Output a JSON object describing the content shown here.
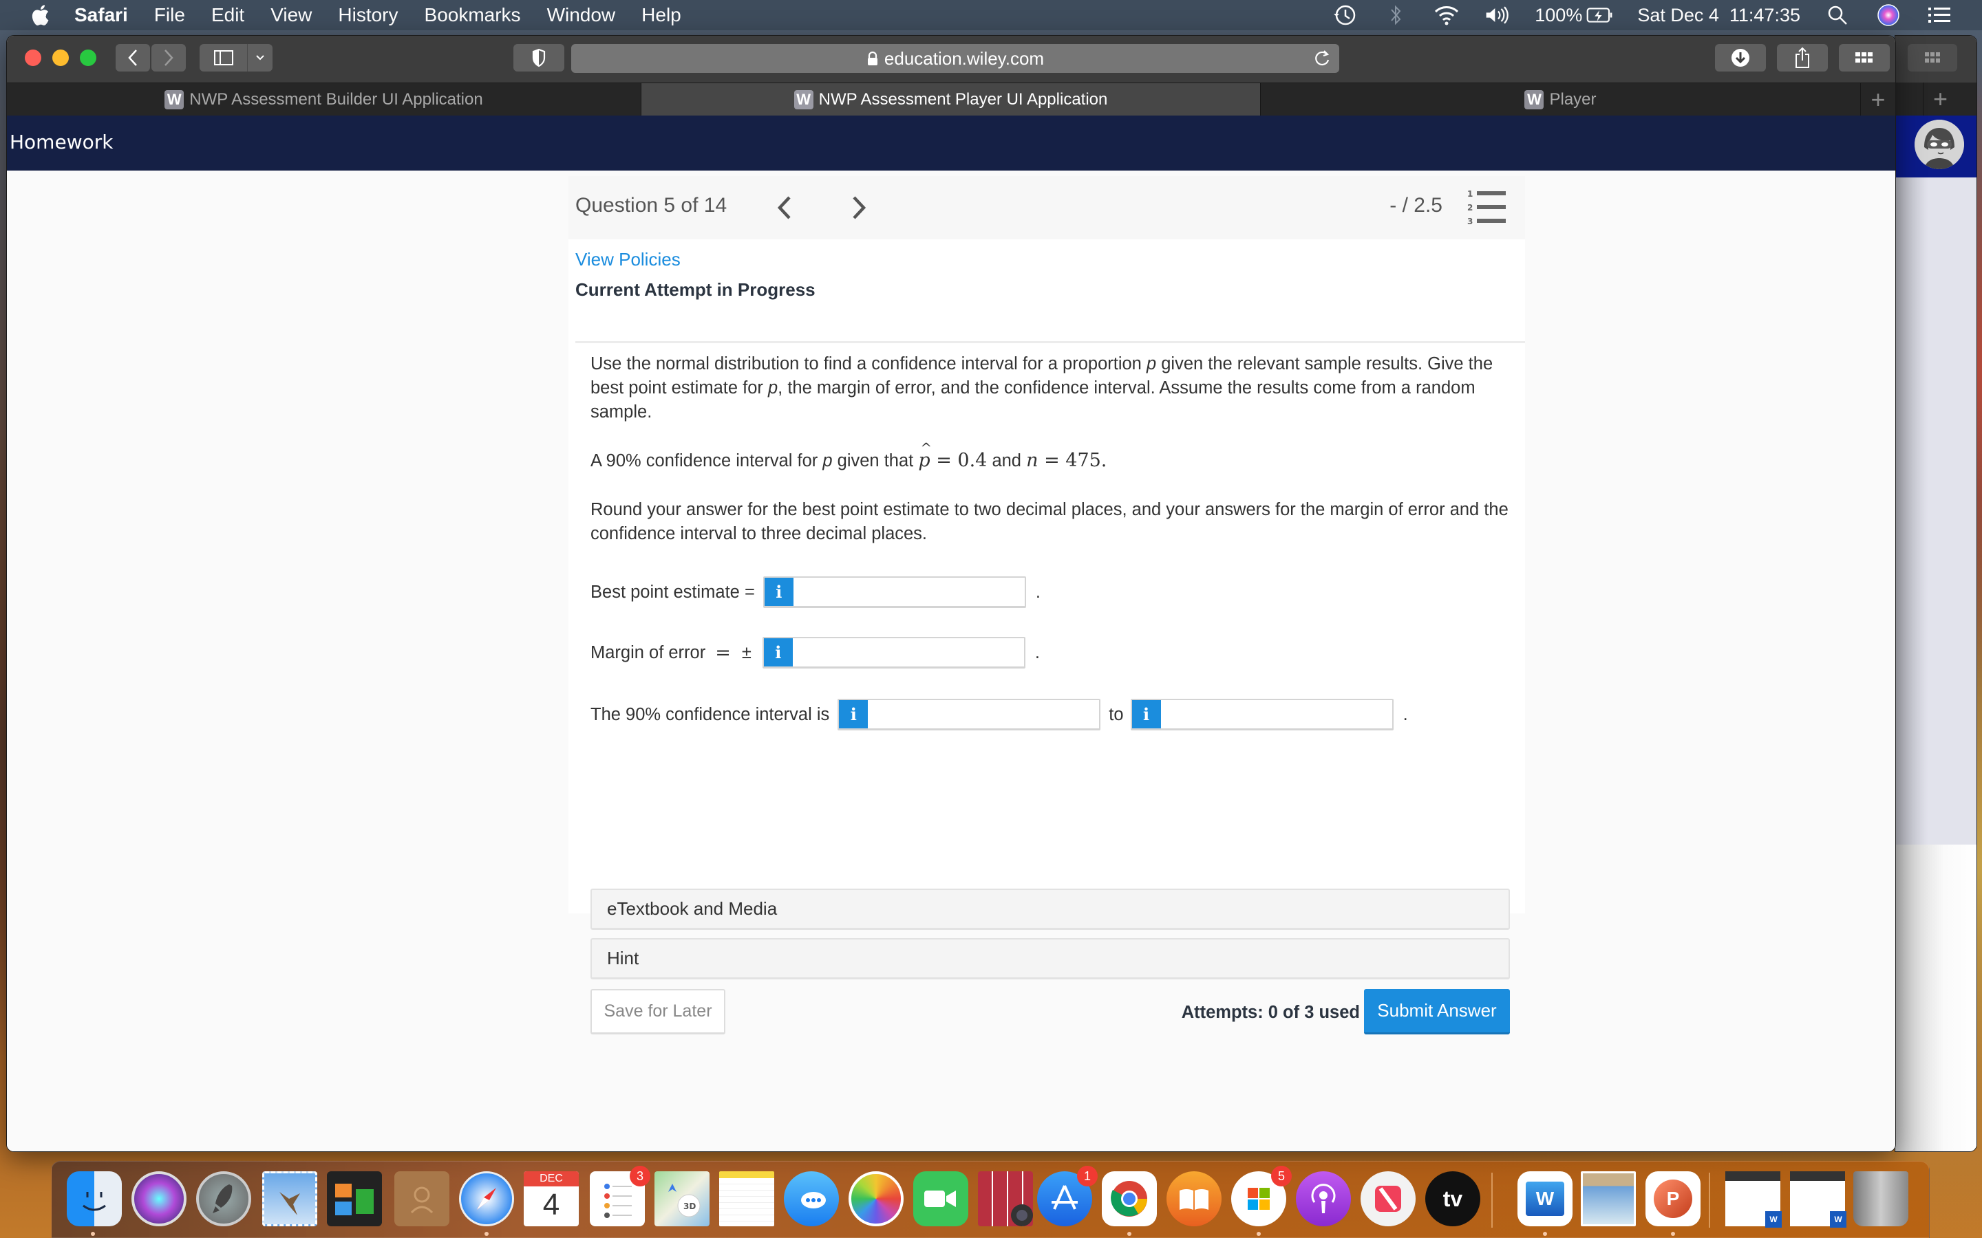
{
  "menubar": {
    "app_name": "Safari",
    "items": [
      "File",
      "Edit",
      "View",
      "History",
      "Bookmarks",
      "Window",
      "Help"
    ],
    "battery": "100%",
    "datetime": "Sat Dec 4  11:47:35",
    "status_icons": [
      "time-machine-icon",
      "bluetooth-icon",
      "wifi-icon",
      "volume-icon",
      "battery-charging-icon",
      "spotlight-search-icon",
      "siri-icon",
      "control-center-icon"
    ]
  },
  "browser": {
    "url": "education.wiley.com",
    "tabs": [
      {
        "favicon": "W",
        "label": "NWP Assessment Builder UI Application",
        "active": false
      },
      {
        "favicon": "W",
        "label": "NWP Assessment Player UI Application",
        "active": true
      },
      {
        "favicon": "W",
        "label": "Player",
        "active": false
      }
    ],
    "new_tab": "+"
  },
  "page": {
    "header_title": "Homework",
    "question_nav": {
      "label": "Question 5 of 14",
      "score": "- / 2.5"
    },
    "view_policies": "View Policies",
    "attempt_heading": "Current Attempt in Progress",
    "question": {
      "intro": "Use the normal distribution to find a confidence interval for a proportion p given the relevant sample results. Give the best point estimate for p, the margin of error, and the confidence interval. Assume the results come from a random sample.",
      "intro_parts": [
        "Use the normal distribution to find a confidence interval for a proportion ",
        "p",
        " given the relevant sample results. Give the best point estimate for ",
        "p",
        ", the margin of error, and the confidence interval. Assume the results come from a random sample."
      ],
      "given_prefix": "A 90% confidence interval for ",
      "given_var": "p",
      "given_mid": " given that ",
      "phat_symbol": "p",
      "phat_value": "= 0.4",
      "and": " and ",
      "n_symbol": "n",
      "n_value": "= 475.",
      "rounding": "Round your answer for the best point estimate to two decimal places, and your answers for the margin of error and the confidence interval to three decimal places."
    },
    "answers": {
      "best_point_label": "Best point estimate =",
      "best_point_value": "",
      "margin_label": "Margin of error",
      "margin_eq": "=",
      "margin_pm": "±",
      "margin_value": "",
      "ci_label": "The 90% confidence interval is",
      "ci_lower_value": "",
      "ci_to": "to",
      "ci_upper_value": "",
      "info_glyph": "i",
      "period": "."
    },
    "expanders": [
      "eTextbook and Media",
      "Hint"
    ],
    "save_for_later": "Save for Later",
    "attempts": "Attempts: 0 of 3 used",
    "submit": "Submit Answer"
  },
  "dock": {
    "apps": [
      {
        "name": "finder",
        "label": ""
      },
      {
        "name": "siri",
        "label": ""
      },
      {
        "name": "launchpad",
        "label": ""
      },
      {
        "name": "mail",
        "label": ""
      },
      {
        "name": "mission-control",
        "label": ""
      },
      {
        "name": "contacts",
        "label": ""
      },
      {
        "name": "safari",
        "label": ""
      },
      {
        "name": "calendar",
        "label": "4",
        "month": "DEC"
      },
      {
        "name": "reminders",
        "label": "",
        "badge": "3"
      },
      {
        "name": "maps",
        "label": ""
      },
      {
        "name": "notes",
        "label": ""
      },
      {
        "name": "messages",
        "label": ""
      },
      {
        "name": "photos",
        "label": ""
      },
      {
        "name": "facetime",
        "label": ""
      },
      {
        "name": "photo-booth",
        "label": ""
      },
      {
        "name": "app-store",
        "label": "",
        "badge": "1"
      },
      {
        "name": "chrome",
        "label": ""
      },
      {
        "name": "books",
        "label": ""
      },
      {
        "name": "microsoft-office",
        "label": "",
        "badge": "5"
      },
      {
        "name": "podcasts",
        "label": ""
      },
      {
        "name": "news",
        "label": ""
      },
      {
        "name": "apple-tv",
        "label": "tv"
      },
      {
        "name": "word",
        "label": "W"
      },
      {
        "name": "preview",
        "label": ""
      },
      {
        "name": "powerpoint",
        "label": "P"
      },
      {
        "name": "document-window-1",
        "label": ""
      },
      {
        "name": "document-window-2",
        "label": ""
      },
      {
        "name": "trash",
        "label": ""
      }
    ]
  },
  "colors": {
    "header_navy": "#152045",
    "accent_blue": "#1b8ddd",
    "link_blue": "#1a8cde"
  }
}
